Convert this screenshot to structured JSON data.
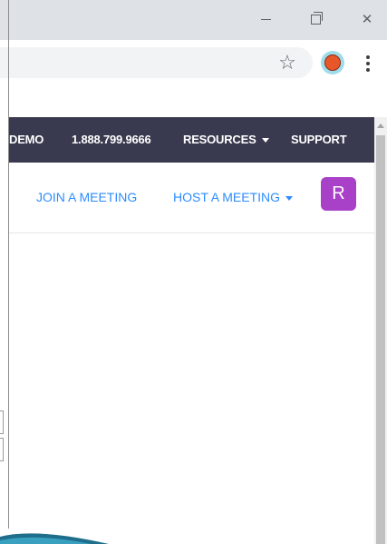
{
  "browser": {
    "window_controls": {
      "minimize_icon": "minimize-icon",
      "restore_icon": "restore-icon",
      "close_icon": "close-icon",
      "close_symbol": "✕"
    },
    "toolbar": {
      "star_symbol": "☆",
      "star_icon": "bookmark-star-icon",
      "extension_icon": "basketball-extension-icon",
      "menu_icon": "kebab-menu-icon"
    }
  },
  "site": {
    "topnav": {
      "demo": "DEMO",
      "phone": "1.888.799.9666",
      "resources": "RESOURCES",
      "support": "SUPPORT",
      "background": "#393a4f"
    },
    "subnav": {
      "join": "JOIN A MEETING",
      "host": "HOST A MEETING",
      "link_color": "#2d8cff"
    },
    "avatar": {
      "initial": "R",
      "color": "#a840c8"
    }
  }
}
